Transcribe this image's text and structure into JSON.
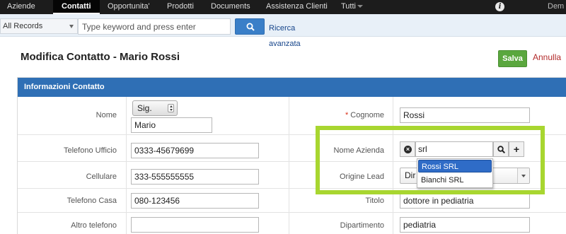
{
  "nav": {
    "items": [
      "Aziende",
      "Contatti",
      "Opportunita'",
      "Prodotti",
      "Documents",
      "Assistenza Clienti",
      "Tutti"
    ],
    "active_index": 1,
    "user_label": "Dem",
    "info_icon": "info-icon"
  },
  "search": {
    "records_value": "All Records",
    "placeholder": "Type keyword and press enter",
    "button_icon": "search-icon",
    "advanced_label": "Ricerca avanzata"
  },
  "page": {
    "title": "Modifica Contatto - Mario Rossi",
    "save_label": "Salva",
    "cancel_label": "Annulla"
  },
  "block": {
    "title": "Informazioni Contatto",
    "fields": {
      "nome_label": "Nome",
      "salutation_value": "Sig.",
      "nome_value": "Mario",
      "cognome_required": "*",
      "cognome_label": "Cognome",
      "cognome_value": "Rossi",
      "tel_ufficio_label": "Telefono Ufficio",
      "tel_ufficio_value": "0333-45679699",
      "nome_azienda_label": "Nome Azienda",
      "nome_azienda_value": "srl",
      "cellulare_label": "Cellulare",
      "cellulare_value": "333-555555555",
      "origine_lead_label": "Origine Lead",
      "origine_lead_value": "Dir",
      "tel_casa_label": "Telefono Casa",
      "tel_casa_value": "080-123456",
      "titolo_label": "Titolo",
      "titolo_value": "dottore in pediatria",
      "altro_tel_label": "Altro telefono",
      "altro_tel_value": "",
      "dipartimento_label": "Dipartimento",
      "dipartimento_value": "pediatria"
    },
    "autocomplete": {
      "options": [
        "Rossi SRL",
        "Bianchi SRL"
      ],
      "selected_index": 0
    }
  },
  "colors": {
    "nav_bg": "#1c1c1c",
    "header_blue": "#2f6fb5",
    "save_green": "#5aa73e",
    "highlight_green": "#a8d630",
    "required_red": "#d9301a"
  }
}
